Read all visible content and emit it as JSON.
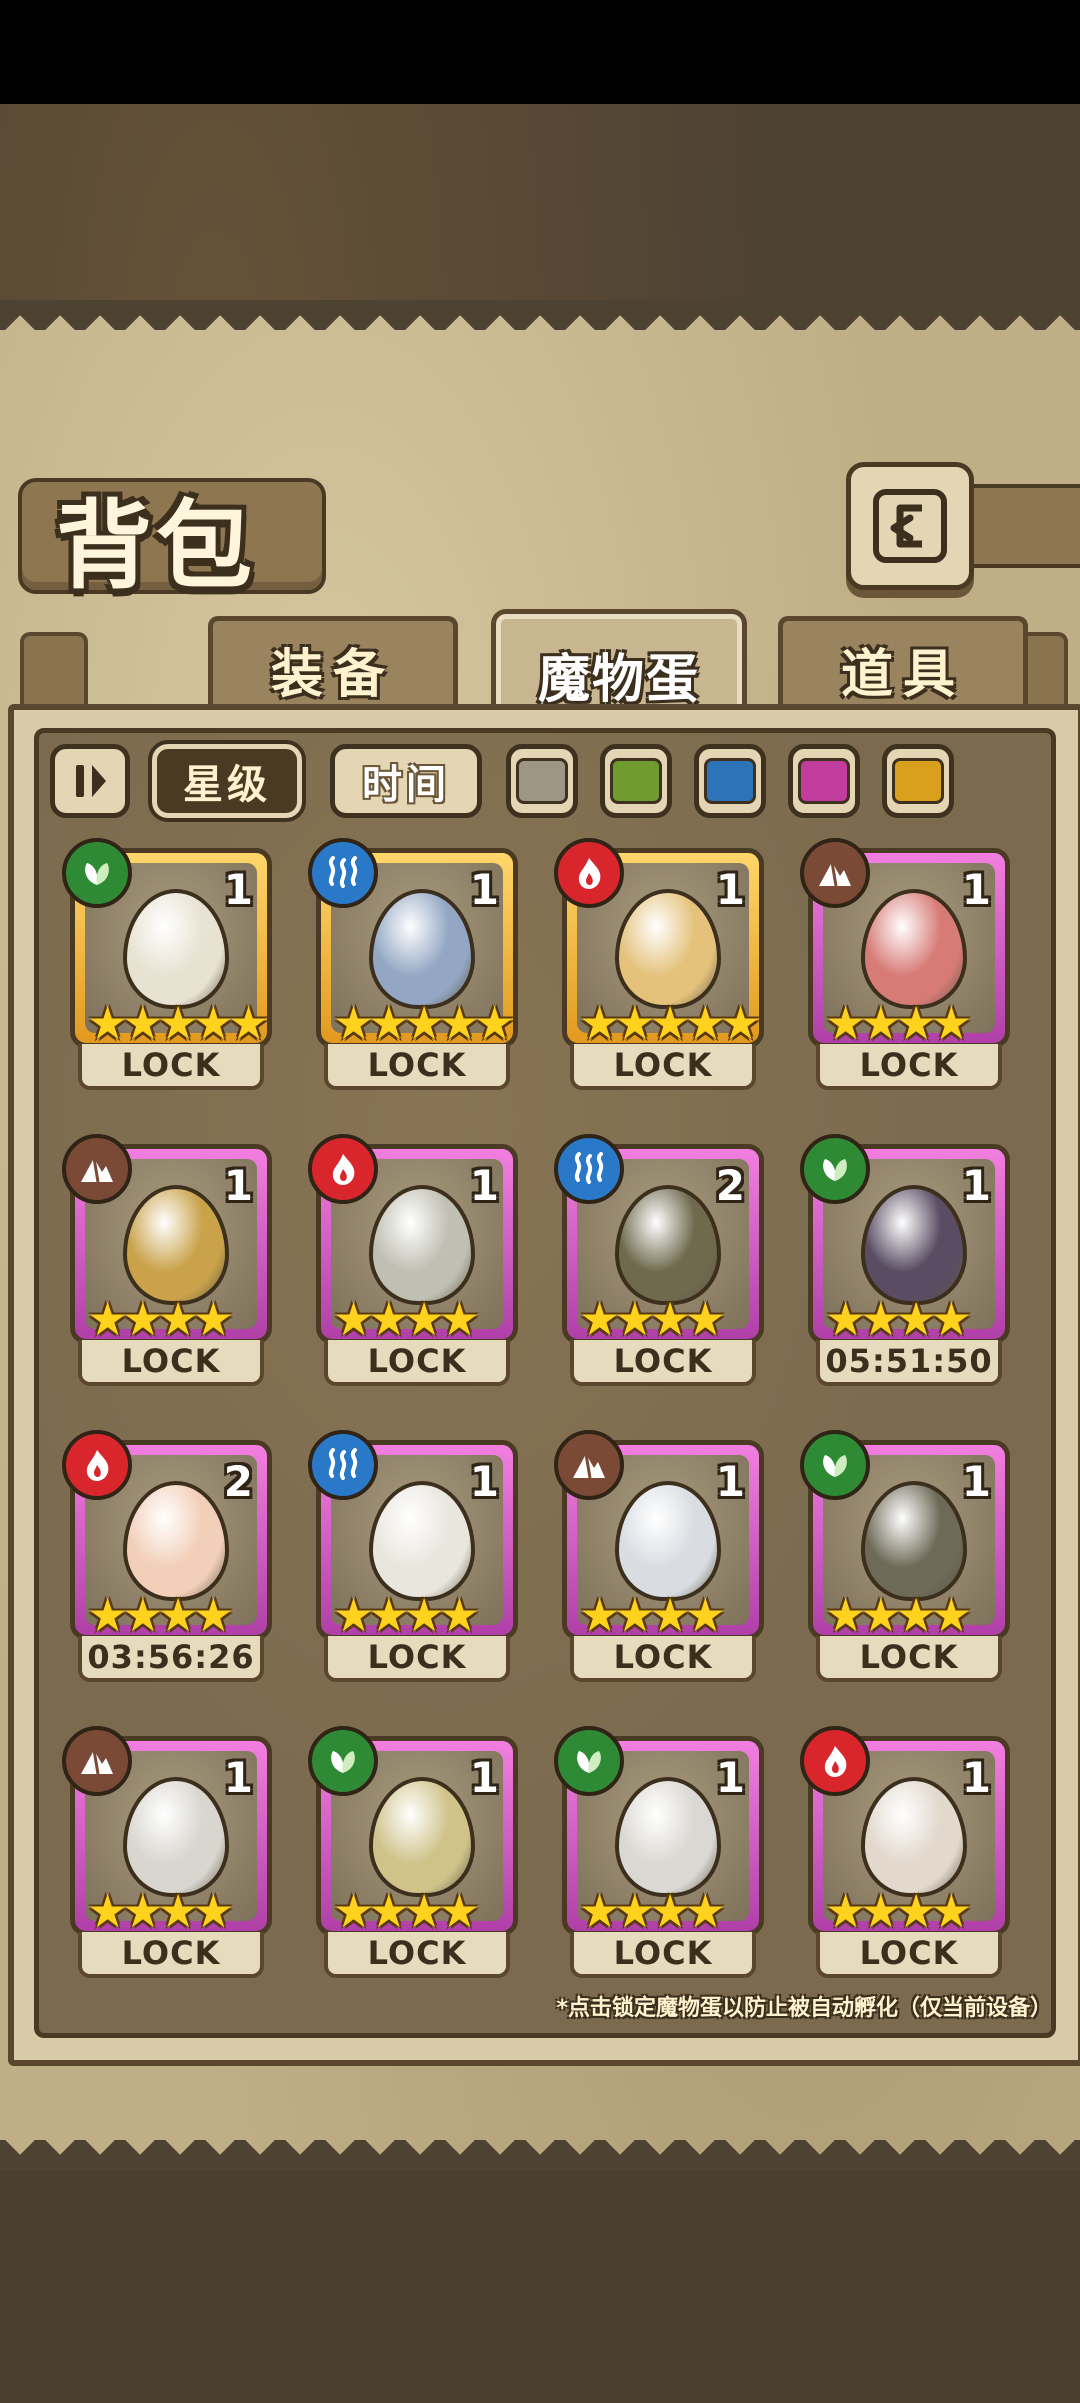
{
  "header": {
    "title": "背包"
  },
  "tabs": [
    {
      "label": "装备",
      "active": false
    },
    {
      "label": "魔物蛋",
      "active": true
    },
    {
      "label": "道具",
      "active": false
    }
  ],
  "filters": {
    "sort_star": "星级",
    "sort_time": "时间",
    "colors": [
      "#9e9684",
      "#6f9b2f",
      "#2c73b8",
      "#c13c9c",
      "#d8a01c"
    ]
  },
  "eggs": [
    {
      "element": "grass",
      "count": "1",
      "stars": 5,
      "rarity": "gold",
      "status": "LOCK",
      "egg_color": "#e8e2d2"
    },
    {
      "element": "water",
      "count": "1",
      "stars": 5,
      "rarity": "gold",
      "status": "LOCK",
      "egg_color": "#93a7c4"
    },
    {
      "element": "fire",
      "count": "1",
      "stars": 5,
      "rarity": "gold",
      "status": "LOCK",
      "egg_color": "#e4c27c"
    },
    {
      "element": "earth",
      "count": "1",
      "stars": 4,
      "rarity": "pink",
      "status": "LOCK",
      "egg_color": "#d77b76"
    },
    {
      "element": "earth",
      "count": "1",
      "stars": 4,
      "rarity": "pink",
      "status": "LOCK",
      "egg_color": "#c9a24a"
    },
    {
      "element": "fire",
      "count": "1",
      "stars": 4,
      "rarity": "pink",
      "status": "LOCK",
      "egg_color": "#bfbfb3"
    },
    {
      "element": "water",
      "count": "2",
      "stars": 4,
      "rarity": "pink",
      "status": "LOCK",
      "egg_color": "#6f6a4e"
    },
    {
      "element": "grass",
      "count": "1",
      "stars": 4,
      "rarity": "pink",
      "status": "05:51:50",
      "egg_color": "#5a4d63"
    },
    {
      "element": "fire",
      "count": "2",
      "stars": 4,
      "rarity": "pink",
      "status": "03:56:26",
      "egg_color": "#f2cfb8"
    },
    {
      "element": "water",
      "count": "1",
      "stars": 4,
      "rarity": "pink",
      "status": "LOCK",
      "egg_color": "#e9e6de"
    },
    {
      "element": "earth",
      "count": "1",
      "stars": 4,
      "rarity": "pink",
      "status": "LOCK",
      "egg_color": "#d9dde2"
    },
    {
      "element": "grass",
      "count": "1",
      "stars": 4,
      "rarity": "pink",
      "status": "LOCK",
      "egg_color": "#6e6a58"
    },
    {
      "element": "earth",
      "count": "1",
      "stars": 4,
      "rarity": "pink",
      "status": "LOCK",
      "egg_color": "#d8d6cf"
    },
    {
      "element": "grass",
      "count": "1",
      "stars": 4,
      "rarity": "pink",
      "status": "LOCK",
      "egg_color": "#cfc38a"
    },
    {
      "element": "grass",
      "count": "1",
      "stars": 4,
      "rarity": "pink",
      "status": "LOCK",
      "egg_color": "#dad8d2"
    },
    {
      "element": "fire",
      "count": "1",
      "stars": 4,
      "rarity": "pink",
      "status": "LOCK",
      "egg_color": "#e2d8cc"
    }
  ],
  "footer_note": "*点击锁定魔物蛋以防止被自动孵化（仅当前设备）"
}
